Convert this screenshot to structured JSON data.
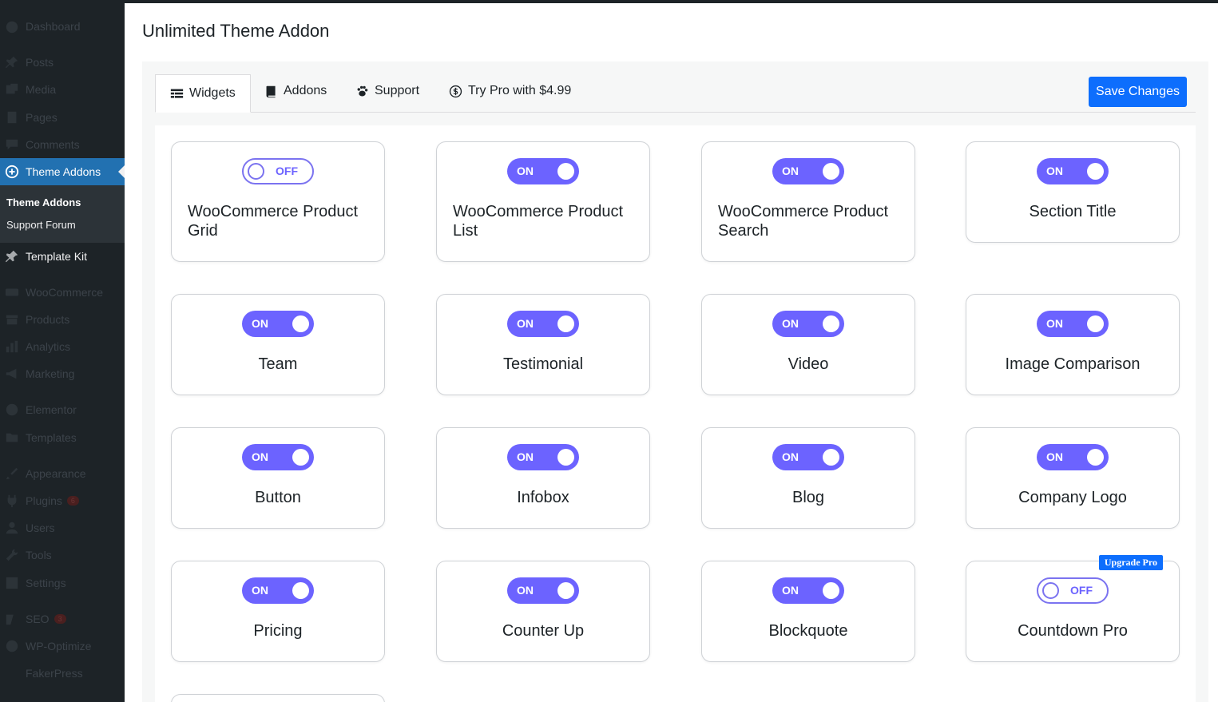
{
  "sidebar": {
    "items": [
      {
        "label": "Dashboard",
        "icon": "dashboard-icon"
      },
      {
        "label": "Posts",
        "icon": "pin-icon"
      },
      {
        "label": "Media",
        "icon": "media-icon"
      },
      {
        "label": "Pages",
        "icon": "pages-icon"
      },
      {
        "label": "Comments",
        "icon": "comment-icon"
      },
      {
        "label": "Theme Addons",
        "icon": "plus-circle-icon"
      },
      {
        "label": "Template Kit",
        "icon": "pin-icon"
      },
      {
        "label": "WooCommerce",
        "icon": "woo-icon"
      },
      {
        "label": "Products",
        "icon": "archive-icon"
      },
      {
        "label": "Analytics",
        "icon": "chart-icon"
      },
      {
        "label": "Marketing",
        "icon": "megaphone-icon"
      },
      {
        "label": "Elementor",
        "icon": "elementor-icon"
      },
      {
        "label": "Templates",
        "icon": "folder-icon"
      },
      {
        "label": "Appearance",
        "icon": "brush-icon"
      },
      {
        "label": "Plugins",
        "icon": "plug-icon",
        "badge": "6"
      },
      {
        "label": "Users",
        "icon": "user-icon"
      },
      {
        "label": "Tools",
        "icon": "wrench-icon"
      },
      {
        "label": "Settings",
        "icon": "settings-icon"
      },
      {
        "label": "SEO",
        "icon": "seo-icon",
        "badge": "3"
      },
      {
        "label": "WP-Optimize",
        "icon": "optimize-icon"
      },
      {
        "label": "FakerPress",
        "icon": ""
      }
    ],
    "submenu": [
      "Theme Addons",
      "Support Forum"
    ]
  },
  "page": {
    "title": "Unlimited Theme Addon"
  },
  "tabs": [
    {
      "label": "Widgets",
      "icon": "widgets-icon",
      "active": true
    },
    {
      "label": "Addons",
      "icon": "book-icon",
      "active": false
    },
    {
      "label": "Support",
      "icon": "paw-icon",
      "active": false
    },
    {
      "label": "Try Pro with $4.99",
      "icon": "dollar-icon",
      "active": false
    }
  ],
  "save_label": "Save Changes",
  "toggle_on_text": "ON",
  "toggle_off_text": "OFF",
  "upgrade_badge": "Upgrade Pro",
  "widgets": [
    {
      "name": "WooCommerce Product Grid",
      "on": false
    },
    {
      "name": "WooCommerce Product List",
      "on": true
    },
    {
      "name": "WooCommerce Product Search",
      "on": true
    },
    {
      "name": "Section Title",
      "on": true
    },
    {
      "name": "Team",
      "on": true
    },
    {
      "name": "Testimonial",
      "on": true
    },
    {
      "name": "Video",
      "on": true
    },
    {
      "name": "Image Comparison",
      "on": true
    },
    {
      "name": "Button",
      "on": true
    },
    {
      "name": "Infobox",
      "on": true
    },
    {
      "name": "Blog",
      "on": true
    },
    {
      "name": "Company Logo",
      "on": true
    },
    {
      "name": "Pricing",
      "on": true
    },
    {
      "name": "Counter Up",
      "on": true
    },
    {
      "name": "Blockquote",
      "on": true
    },
    {
      "name": "Countdown Pro",
      "on": false,
      "pro": true
    }
  ]
}
